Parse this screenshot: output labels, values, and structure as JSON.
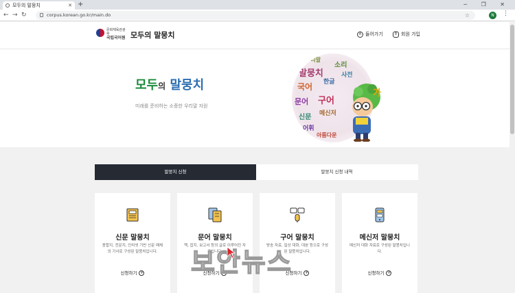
{
  "browser": {
    "tab_title": "모두의 말뭉치",
    "new_tab": "+",
    "url": "corpus.korean.go.kr/main.do",
    "profile_initial": "N",
    "window_controls": "─ ❐ ✕"
  },
  "header": {
    "institution_line1": "문화체육관광부",
    "institution_line2": "국립국어원",
    "site_title": "모두의 말뭉치",
    "login_label": "들어가기",
    "signup_label": "회원 가입"
  },
  "hero": {
    "title_part1": "모두",
    "title_part2": "의",
    "title_part3": "말뭉치",
    "subtitle": "미래를 준비하는 소중한 우리말 자원",
    "cloud_words": [
      "말뭉치",
      "소리",
      "국어",
      "한글",
      "문어",
      "구어",
      "신문",
      "메신저",
      "어휘",
      "아름다운",
      "사전",
      "우리말"
    ]
  },
  "tabs": {
    "active": "말뭉치 신청",
    "inactive": "말뭉치 신청 내역"
  },
  "cards": [
    {
      "title": "신문 말뭉치",
      "desc": "종합지, 전문지, 인터넷 기반 신문 매체의 기사로 구성된 말뭉치입니다.",
      "link": "신청하기"
    },
    {
      "title": "문어 말뭉치",
      "desc": "책, 잡지, 보고서 등의 글로 이루어진 자료입니다.",
      "link": "신청하기"
    },
    {
      "title": "구어 말뭉치",
      "desc": "방송 자료, 일상 대화, 대본 등으로 구성된 말뭉치입니다.",
      "link": "신청하기"
    },
    {
      "title": "메신저 말뭉치",
      "desc": "메신저 대화 자료로 구성된 말뭉치입니다.",
      "link": "신청하기"
    }
  ],
  "watermark": "보안뉴스"
}
